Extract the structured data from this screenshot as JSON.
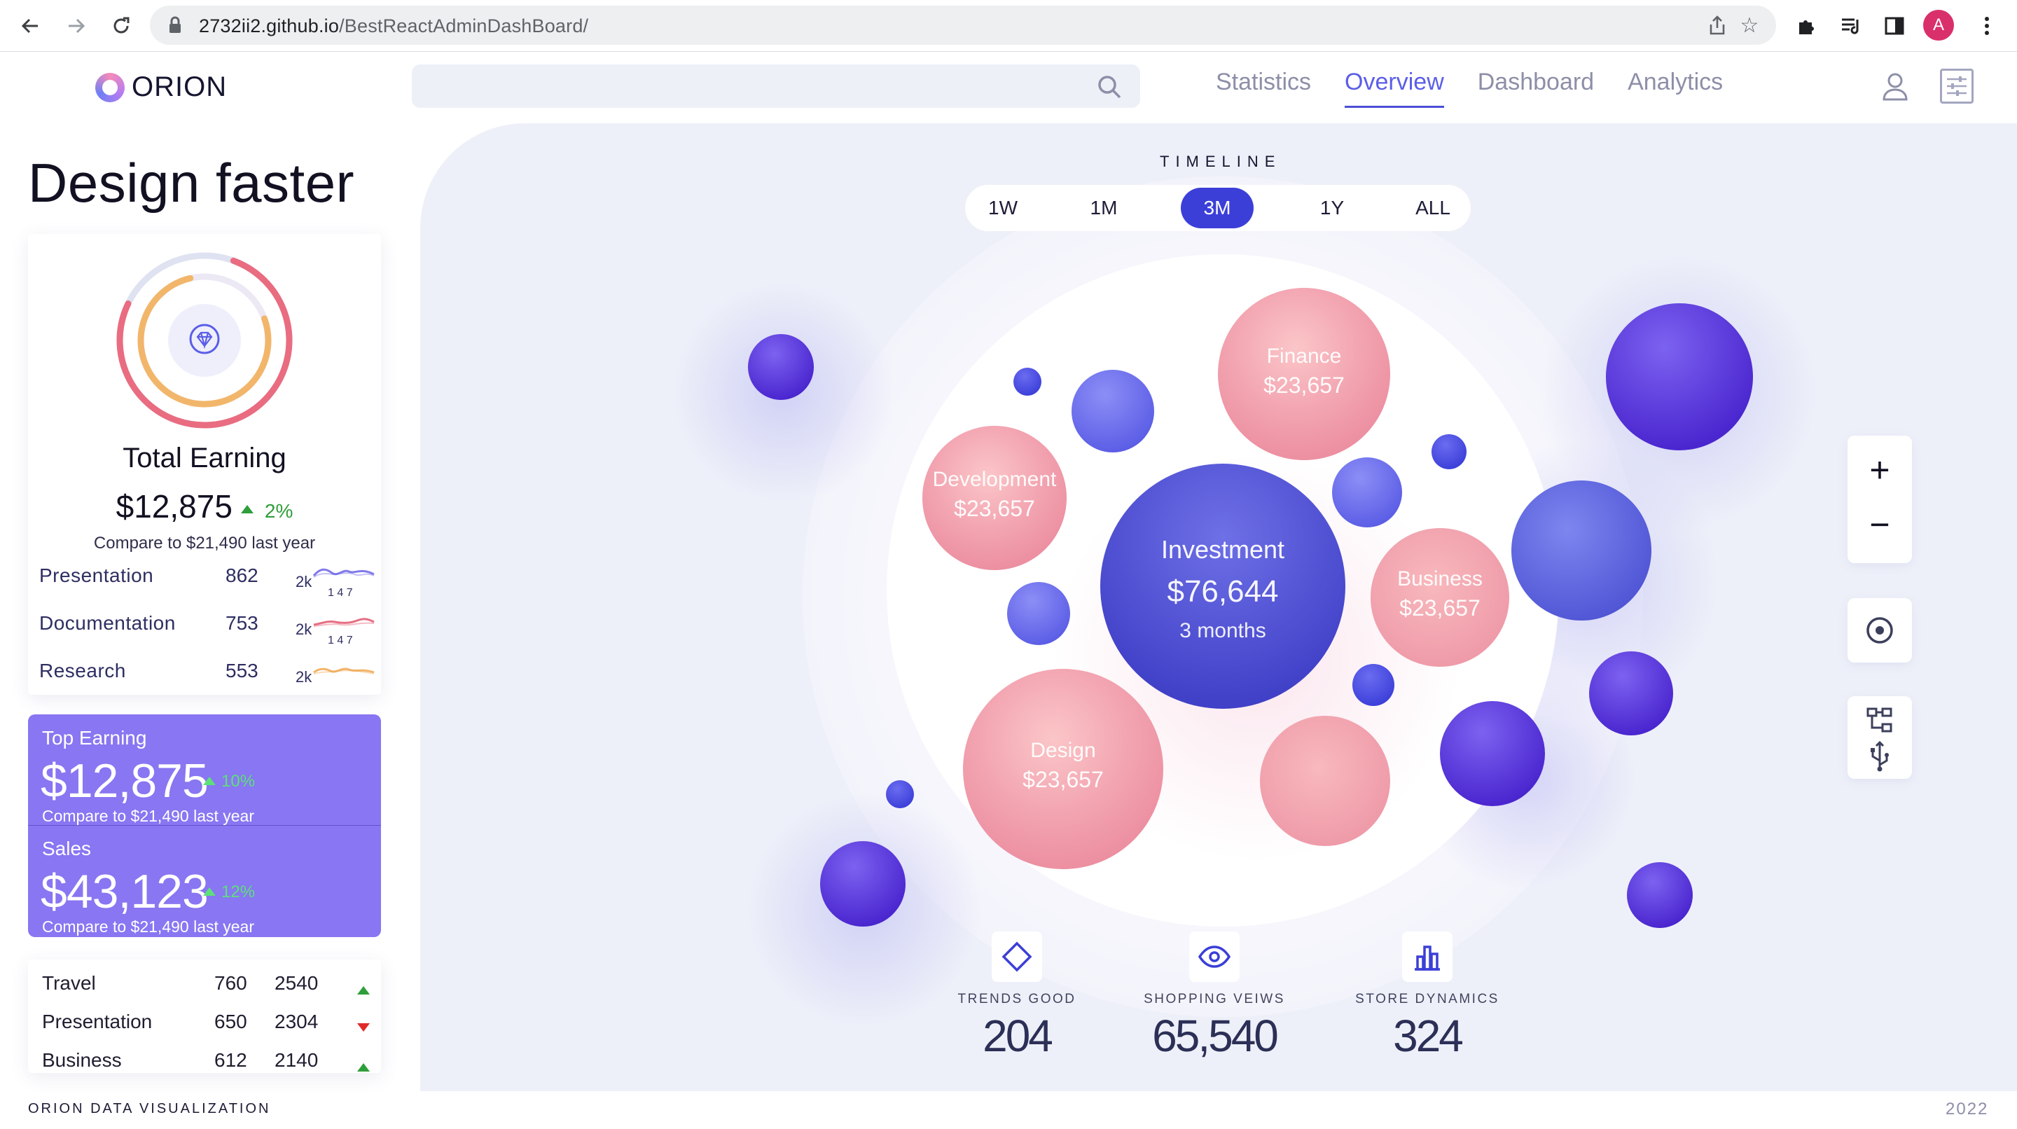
{
  "browser": {
    "url_host": "2732ii2.github.io",
    "url_path": "/BestReactAdminDashBoard/",
    "profile_initial": "A",
    "icons": [
      "back-icon",
      "forward-icon",
      "reload-icon",
      "lock-icon",
      "share-icon",
      "star-icon",
      "extensions-icon",
      "media-icon",
      "sidebar-icon",
      "menu-icon"
    ]
  },
  "app": {
    "brand": "ORION",
    "search_placeholder": "",
    "nav": [
      "Statistics",
      "Overview",
      "Dashboard",
      "Analytics"
    ],
    "active_nav": "Overview",
    "accent_color": "#3b3fd8"
  },
  "left": {
    "hero_title": "Design faster",
    "earning_card": {
      "title": "Total Earning",
      "value": "$12,875",
      "delta": "2%",
      "compare": "Compare to $21,490 last year",
      "donut_icon": "diamond-icon",
      "rows": [
        {
          "label": "Presentation",
          "value": "862",
          "unit": "2k",
          "ticks": "1 4 7",
          "color": "#6b63e6"
        },
        {
          "label": "Documentation",
          "value": "753",
          "unit": "2k",
          "ticks": "1 4 7",
          "color": "#e0566d"
        },
        {
          "label": "Research",
          "value": "553",
          "unit": "2k",
          "ticks": "",
          "color": "#f0a74f"
        }
      ]
    },
    "top_earning": {
      "label": "Top Earning",
      "value": "$12,875",
      "delta": "10%",
      "compare": "Compare to $21,490 last year"
    },
    "sales": {
      "label": "Sales",
      "value": "$43,123",
      "delta": "12%",
      "compare": "Compare to $21,490 last year"
    },
    "list": [
      {
        "name": "Travel",
        "a": "760",
        "b": "2540",
        "trend": "up"
      },
      {
        "name": "Presentation",
        "a": "650",
        "b": "2304",
        "trend": "down"
      },
      {
        "name": "Business",
        "a": "612",
        "b": "2140",
        "trend": "up"
      }
    ]
  },
  "viz": {
    "timeline_label": "TIMELINE",
    "timeline_options": [
      "1W",
      "1M",
      "3M",
      "1Y",
      "ALL"
    ],
    "timeline_selected": "3M",
    "center_bubble": {
      "label": "Investment",
      "value": "$76,644",
      "sub": "3 months"
    },
    "bubbles": [
      {
        "label": "Finance",
        "value": "$23,657"
      },
      {
        "label": "Development",
        "value": "$23,657"
      },
      {
        "label": "Business",
        "value": "$23,657"
      },
      {
        "label": "Design",
        "value": "$23,657"
      }
    ],
    "controls": {
      "zoom_in": "+",
      "zoom_out": "−"
    },
    "kpis": [
      {
        "label": "TRENDS GOOD",
        "value": "204",
        "icon": "diamond-icon"
      },
      {
        "label": "SHOPPING VEIWS",
        "value": "65,540",
        "icon": "eye-icon"
      },
      {
        "label": "STORE DYNAMICS",
        "value": "324",
        "icon": "bar-chart-icon"
      }
    ]
  },
  "footer": {
    "left": "ORION DATA VISUALIZATION",
    "right": "2022"
  }
}
